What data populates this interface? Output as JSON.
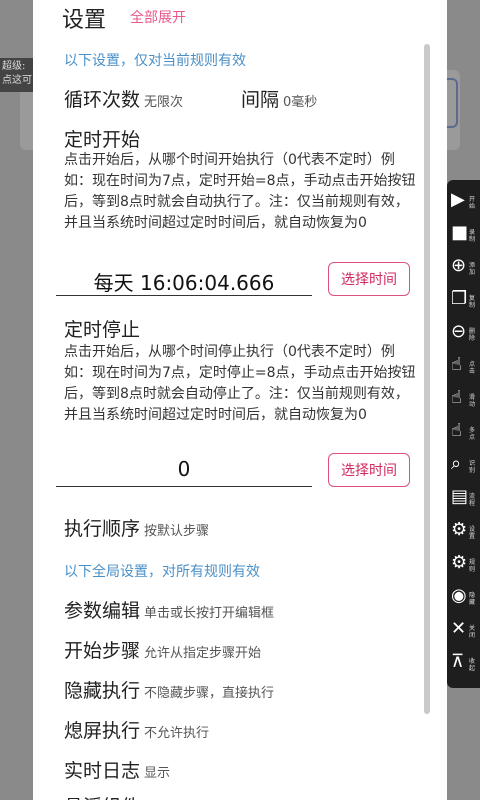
{
  "background": {
    "chip_line1": "超级:",
    "chip_line2": "点这可"
  },
  "toolbar": [
    {
      "icon": "play-icon",
      "glyph": "▶",
      "label": "开始"
    },
    {
      "icon": "record-icon",
      "glyph": "■",
      "label": "录制"
    },
    {
      "icon": "add-icon",
      "glyph": "⊕",
      "label": "添加"
    },
    {
      "icon": "copy-icon",
      "glyph": "❐",
      "label": "复制"
    },
    {
      "icon": "delete-icon",
      "glyph": "⊖",
      "label": "删除"
    },
    {
      "icon": "click-icon",
      "glyph": "☝",
      "label": "点击"
    },
    {
      "icon": "swipe-icon",
      "glyph": "☝",
      "label": "滑动"
    },
    {
      "icon": "multi-touch-icon",
      "glyph": "☝",
      "label": "多点"
    },
    {
      "icon": "recognize-icon",
      "glyph": "⌕",
      "label": "识别"
    },
    {
      "icon": "flow-icon",
      "glyph": "▤",
      "label": "流程"
    },
    {
      "icon": "settings-icon",
      "glyph": "⚙",
      "label": "设置"
    },
    {
      "icon": "rule-icon",
      "glyph": "⚙",
      "label": "规则"
    },
    {
      "icon": "hide-icon",
      "glyph": "◉",
      "label": "隐藏"
    },
    {
      "icon": "close-icon",
      "glyph": "✕",
      "label": "关闭"
    },
    {
      "icon": "collapse-icon",
      "glyph": "⊼",
      "label": "收起"
    }
  ],
  "dialog": {
    "title": "设置",
    "expand_all": "全部展开",
    "current_rule_hint": "以下设置，仅对当前规则有效",
    "loop_count_label": "循环次数",
    "loop_count_value": "无限次",
    "interval_label": "间隔",
    "interval_value": "0毫秒",
    "timed_start": {
      "label": "定时开始",
      "desc": "点击开始后，从哪个时间开始执行（0代表不定时）例如：现在时间为7点，定时开始=8点，手动点击开始按钮后，等到8点时就会自动执行了。注：仅当前规则有效，并且当系统时间超过定时时间后，就自动恢复为0",
      "value": "每天 16:06:04.666",
      "button": "选择时间"
    },
    "timed_stop": {
      "label": "定时停止",
      "desc": "点击开始后，从哪个时间停止执行（0代表不定时）例如：现在时间为7点，定时停止=8点，手动点击开始按钮后，等到8点时就会自动停止了。注：仅当前规则有效，并且当系统时间超过定时时间后，就自动恢复为0",
      "value": "0",
      "button": "选择时间"
    },
    "exec_order_label": "执行顺序",
    "exec_order_value": "按默认步骤",
    "global_hint": "以下全局设置，对所有规则有效",
    "param_edit_label": "参数编辑",
    "param_edit_value": "单击或长按打开编辑框",
    "start_step_label": "开始步骤",
    "start_step_value": "允许从指定步骤开始",
    "hidden_exec_label": "隐藏执行",
    "hidden_exec_value": "不隐藏步骤，直接执行",
    "screen_off_label": "熄屏执行",
    "screen_off_value": "不允许执行",
    "realtime_log_label": "实时日志",
    "realtime_log_value": "显示",
    "partial_label": "悬浮组件"
  },
  "colors": {
    "accent_pink": "#e0507e",
    "hint_blue": "#4a90c8",
    "toolbar_bg": "#1e1e1e"
  }
}
